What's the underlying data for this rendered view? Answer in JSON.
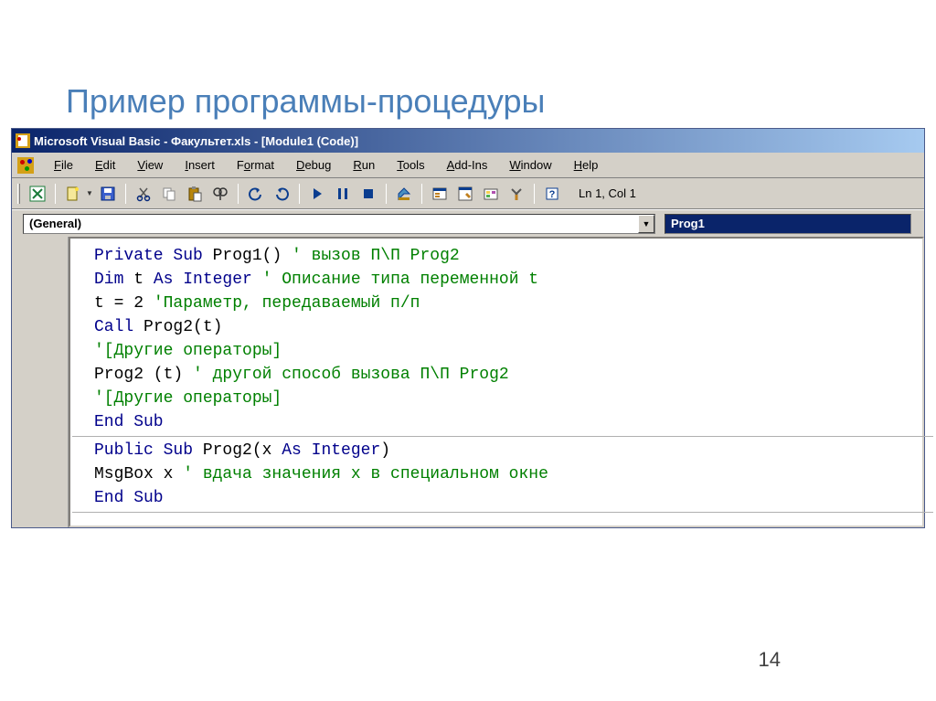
{
  "slide": {
    "title": "Пример программы-процедуры",
    "page": "14"
  },
  "titlebar": {
    "text": "Microsoft Visual Basic - Факультет.xls - [Module1 (Code)]"
  },
  "menu": {
    "file": "File",
    "edit": "Edit",
    "view": "View",
    "insert": "Insert",
    "format": "Format",
    "debug": "Debug",
    "run": "Run",
    "tools": "Tools",
    "addins": "Add-Ins",
    "window": "Window",
    "help": "Help"
  },
  "status": {
    "pos": "Ln 1, Col 1"
  },
  "combos": {
    "left": "(General)",
    "right": "Prog1"
  },
  "code": {
    "l1a": "Private Sub",
    "l1b": " Prog1() ",
    "l1c": "' вызов П\\П Prog2",
    "l2a": "Dim",
    "l2b": " t ",
    "l2c": "As Integer",
    "l2d": " ",
    "l2e": "' Описание типа переменной t",
    "l3a": "t = 2 ",
    "l3b": "'Параметр, передаваемый п/п",
    "l4a": "Call",
    "l4b": " Prog2(t)",
    "l5a": "'[Другие операторы]",
    "l6a": "Prog2 (t) ",
    "l6b": "' другой способ вызова П\\П Prog2",
    "l7a": "'[Другие операторы]",
    "l8a": "End Sub",
    "l9a": "Public Sub",
    "l9b": " Prog2(x ",
    "l9c": "As Integer",
    "l9d": ")",
    "l10a": "MsgBox x ",
    "l10b": "' вдача значения x в специальном окне",
    "l11a": "End Sub"
  }
}
